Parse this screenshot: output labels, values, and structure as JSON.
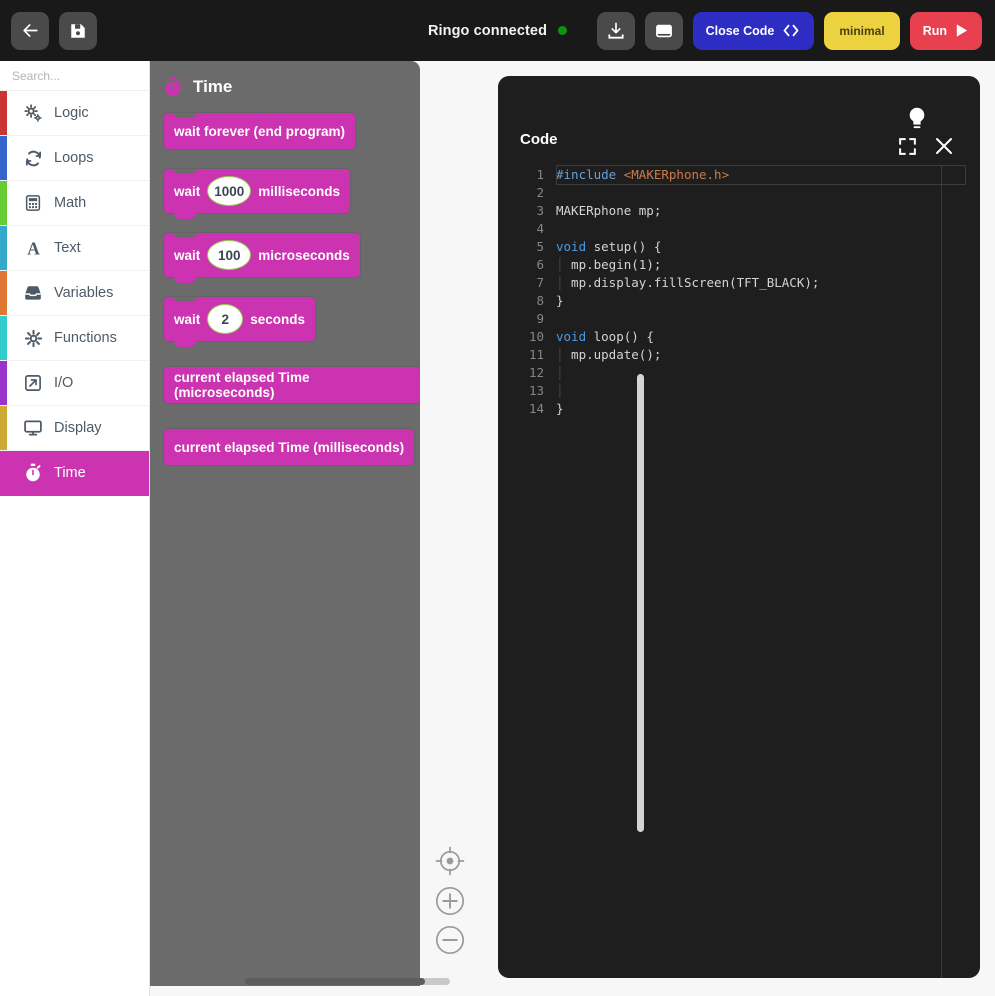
{
  "topbar": {
    "back_label": "back",
    "save_label": "save",
    "status_text": "Ringo connected",
    "status_color": "#119111",
    "download_label": "download",
    "serial_label": "serial-monitor",
    "close_code_label": "Close Code",
    "minimal_label": "minimal",
    "run_label": "Run"
  },
  "toolbox": {
    "search_placeholder": "Search...",
    "search_value": "",
    "categories": [
      {
        "label": "Logic",
        "color": "#cc3333",
        "icon": "gears-icon"
      },
      {
        "label": "Loops",
        "color": "#3366cc",
        "icon": "refresh-icon"
      },
      {
        "label": "Math",
        "color": "#66cc33",
        "icon": "calculator-icon"
      },
      {
        "label": "Text",
        "color": "#33aacc",
        "icon": "letter-a-icon"
      },
      {
        "label": "Variables",
        "color": "#dd7733",
        "icon": "inbox-icon"
      },
      {
        "label": "Functions",
        "color": "#33cccc",
        "icon": "gear-icon"
      },
      {
        "label": "I/O",
        "color": "#9933cc",
        "icon": "arrow-out-icon"
      },
      {
        "label": "Display",
        "color": "#ccaa33",
        "icon": "monitor-icon"
      },
      {
        "label": "Time",
        "color": "#cc33b0",
        "icon": "stopwatch-icon"
      }
    ],
    "active_category": "Time"
  },
  "flyout": {
    "title": "Time",
    "icon": "stopwatch-icon",
    "background": "#6b6b6b",
    "block_color": "#cc33b0",
    "blocks": [
      {
        "type": "statement",
        "has_bottom": false,
        "parts": [
          {
            "kind": "text",
            "text": "wait forever (end program)"
          }
        ]
      },
      {
        "type": "statement",
        "has_bottom": true,
        "parts": [
          {
            "kind": "text",
            "text": "wait"
          },
          {
            "kind": "field",
            "value": "1000"
          },
          {
            "kind": "text",
            "text": "milliseconds"
          }
        ]
      },
      {
        "type": "statement",
        "has_bottom": true,
        "parts": [
          {
            "kind": "text",
            "text": "wait"
          },
          {
            "kind": "field",
            "value": "100"
          },
          {
            "kind": "text",
            "text": "microseconds"
          }
        ]
      },
      {
        "type": "statement",
        "has_bottom": true,
        "parts": [
          {
            "kind": "text",
            "text": "wait"
          },
          {
            "kind": "field",
            "value": "2",
            "narrow": true
          },
          {
            "kind": "text",
            "text": "seconds"
          }
        ]
      },
      {
        "type": "value",
        "has_bottom": false,
        "parts": [
          {
            "kind": "text",
            "text": "current elapsed Time (microseconds)"
          }
        ]
      },
      {
        "type": "value",
        "has_bottom": false,
        "parts": [
          {
            "kind": "text",
            "text": "current elapsed Time (milliseconds)"
          }
        ]
      }
    ]
  },
  "zoom_controls": {
    "center_label": "center-workspace",
    "zoom_in_label": "zoom-in",
    "zoom_out_label": "zoom-out"
  },
  "code_panel": {
    "title": "Code",
    "bulb_label": "hint",
    "expand_label": "fullscreen",
    "close_label": "close",
    "active_line": 1,
    "lines": [
      {
        "n": "1",
        "tokens": [
          {
            "c": "tok-pre",
            "t": "#include"
          },
          {
            "c": "tok-plain",
            "t": " "
          },
          {
            "c": "tok-str",
            "t": "<MAKERphone.h>"
          }
        ]
      },
      {
        "n": "2",
        "tokens": []
      },
      {
        "n": "3",
        "tokens": [
          {
            "c": "tok-plain",
            "t": "MAKERphone mp;"
          }
        ]
      },
      {
        "n": "4",
        "tokens": []
      },
      {
        "n": "5",
        "tokens": [
          {
            "c": "tok-kw",
            "t": "void"
          },
          {
            "c": "tok-plain",
            "t": " setup() {"
          }
        ]
      },
      {
        "n": "6",
        "tokens": [
          {
            "c": "guide",
            "t": "│"
          },
          {
            "c": "tok-plain",
            "t": " mp.begin(1);"
          }
        ]
      },
      {
        "n": "7",
        "tokens": [
          {
            "c": "guide",
            "t": "│"
          },
          {
            "c": "tok-plain",
            "t": " mp.display.fillScreen(TFT_BLACK);"
          }
        ]
      },
      {
        "n": "8",
        "tokens": [
          {
            "c": "tok-plain",
            "t": "}"
          }
        ]
      },
      {
        "n": "9",
        "tokens": []
      },
      {
        "n": "10",
        "tokens": [
          {
            "c": "tok-kw",
            "t": "void"
          },
          {
            "c": "tok-plain",
            "t": " loop() {"
          }
        ]
      },
      {
        "n": "11",
        "tokens": [
          {
            "c": "guide",
            "t": "│"
          },
          {
            "c": "tok-plain",
            "t": " mp.update();"
          }
        ]
      },
      {
        "n": "12",
        "tokens": [
          {
            "c": "guide",
            "t": "│"
          }
        ]
      },
      {
        "n": "13",
        "tokens": [
          {
            "c": "guide",
            "t": "│"
          }
        ]
      },
      {
        "n": "14",
        "tokens": [
          {
            "c": "tok-plain",
            "t": "}"
          }
        ]
      }
    ]
  }
}
